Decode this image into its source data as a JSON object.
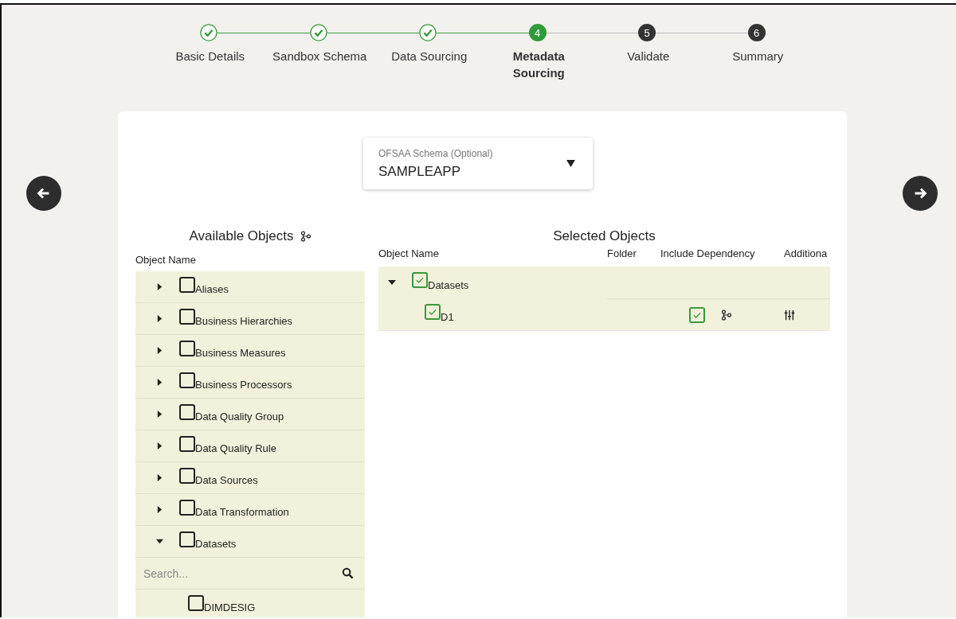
{
  "steps": [
    {
      "label": "Basic Details",
      "completed": true,
      "selected": false
    },
    {
      "label": "Sandbox Schema",
      "completed": true,
      "selected": false
    },
    {
      "label": "Data Sourcing",
      "completed": true,
      "selected": false
    },
    {
      "label": "Metadata Sourcing",
      "completed": false,
      "selected": true,
      "number": "4"
    },
    {
      "label": "Validate",
      "completed": false,
      "selected": false,
      "number": "5"
    },
    {
      "label": "Summary",
      "completed": false,
      "selected": false,
      "number": "6"
    }
  ],
  "schema_dropdown": {
    "label": "OFSAA Schema (Optional)",
    "value": "SAMPLEAPP"
  },
  "available_objects": {
    "title": "Available Objects",
    "column": "Object Name",
    "items": [
      {
        "label": "Aliases",
        "checked": false,
        "expanded": false
      },
      {
        "label": "Business Hierarchies",
        "checked": false,
        "expanded": false
      },
      {
        "label": "Business Measures",
        "checked": false,
        "expanded": false
      },
      {
        "label": "Business Processors",
        "checked": false,
        "expanded": false
      },
      {
        "label": "Data Quality Group",
        "checked": false,
        "expanded": false
      },
      {
        "label": "Data Quality Rule",
        "checked": false,
        "expanded": false
      },
      {
        "label": "Data Sources",
        "checked": false,
        "expanded": false
      },
      {
        "label": "Data Transformation",
        "checked": false,
        "expanded": false
      },
      {
        "label": "Datasets",
        "checked": false,
        "expanded": true,
        "search_placeholder": "Search...",
        "children": [
          {
            "label": "DIMDESIG",
            "checked": false
          }
        ]
      }
    ]
  },
  "selected_objects": {
    "title": "Selected Objects",
    "columns": [
      "Object Name",
      "Folder",
      "Include Dependency",
      "Additiona"
    ],
    "rows": [
      {
        "label": "Datasets",
        "checked": true,
        "expanded": true,
        "children": [
          {
            "label": "D1",
            "checked": true,
            "include_dependency": true
          }
        ]
      }
    ]
  }
}
